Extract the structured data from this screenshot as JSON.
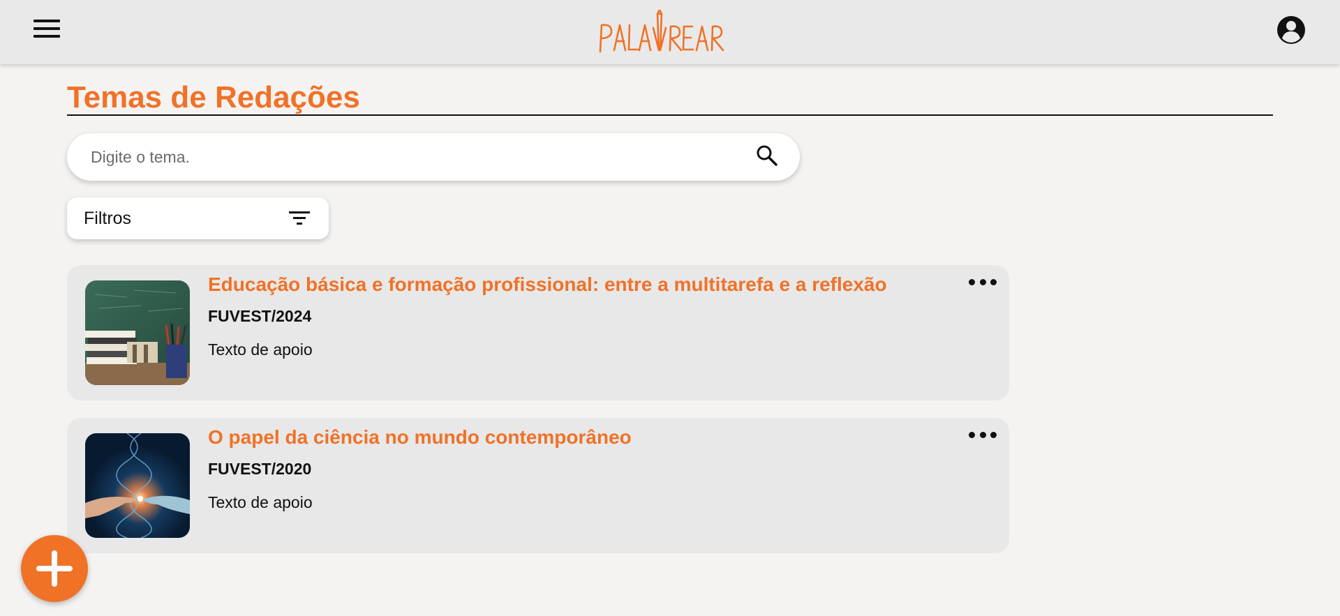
{
  "header": {
    "menu_icon": "hamburger-menu-icon",
    "logo_text": "PALAVREAR",
    "profile_icon": "account-circle-icon",
    "brand_color": "#f07227"
  },
  "page": {
    "title": "Temas de Redações"
  },
  "search": {
    "placeholder": "Digite o tema.",
    "value": "",
    "icon": "search-icon"
  },
  "filters": {
    "label": "Filtros",
    "icon": "filter-list-icon"
  },
  "themes": [
    {
      "title": "Educação básica e formação profissional: entre a multitarefa e a reflexão",
      "source": "FUVEST/2024",
      "support_text": "Texto de apoio",
      "image": "books-and-pencils-chalkboard",
      "more_icon": "more-horizontal-icon"
    },
    {
      "title": "O papel da ciência no mundo contemporâneo",
      "source": "FUVEST/2020",
      "support_text": "Texto de apoio",
      "image": "dna-human-robot-hand",
      "more_icon": "more-horizontal-icon"
    }
  ],
  "fab": {
    "icon": "add-icon"
  }
}
